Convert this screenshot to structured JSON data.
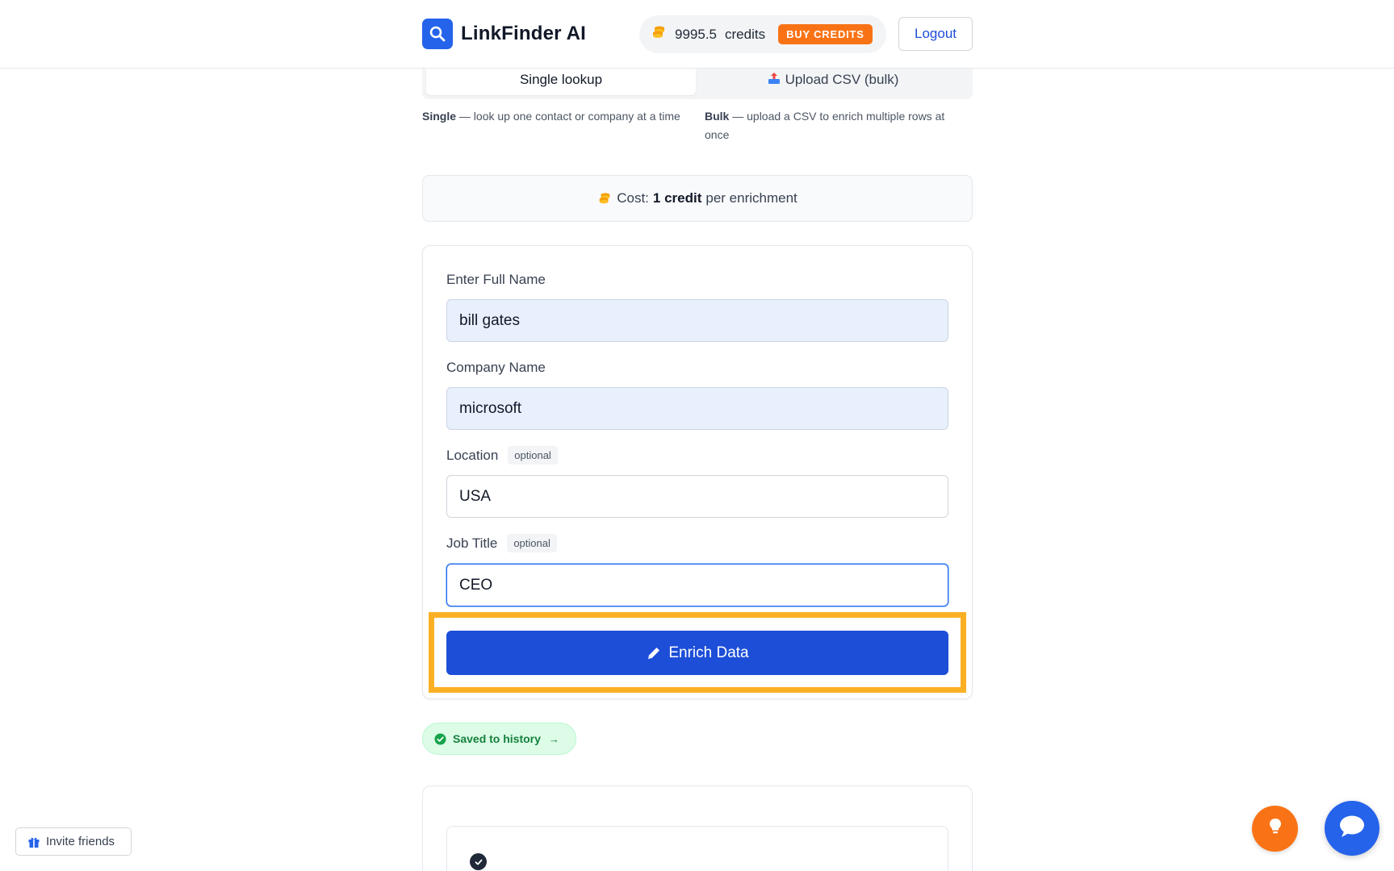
{
  "app": {
    "name": "LinkFinder AI"
  },
  "header": {
    "credits_amount": "9995.5",
    "credits_word": "credits",
    "buy_label": "BUY CREDITS",
    "logout_label": "Logout"
  },
  "tabs": {
    "single_label": "Single lookup",
    "bulk_label": "Upload CSV (bulk)"
  },
  "descriptions": {
    "single_title": "Single",
    "single_text": " — look up one contact or company at a time",
    "bulk_title": "Bulk",
    "bulk_text": " — upload a CSV to enrich multiple rows at once"
  },
  "cost": {
    "prefix": "Cost:",
    "amount": "1 credit",
    "suffix": "per enrichment"
  },
  "form": {
    "full_name_label": "Enter Full Name",
    "full_name_value": "bill gates",
    "company_label": "Company Name",
    "company_value": "microsoft",
    "location_label": "Location",
    "location_value": "USA",
    "job_title_label": "Job Title",
    "job_title_value": "CEO",
    "optional_badge": "optional",
    "submit_label": "Enrich Data"
  },
  "status": {
    "saved_label": "Saved to history",
    "saved_arrow": "→"
  },
  "footer": {
    "invite_label": "Invite friends"
  },
  "colors": {
    "primary": "#1d4ed8",
    "accent_orange": "#f97316",
    "highlight": "#fbb024",
    "success_bg": "#dcfce7",
    "success_text": "#15803d"
  },
  "icons": {
    "logo": "search-icon",
    "credits": "coins-icon",
    "bulk_tab": "upload-icon",
    "submit": "pencil-icon",
    "saved": "check-circle-icon",
    "invite": "gift-icon",
    "fab_orange": "lightbulb-icon",
    "fab_blue": "chat-icon"
  }
}
